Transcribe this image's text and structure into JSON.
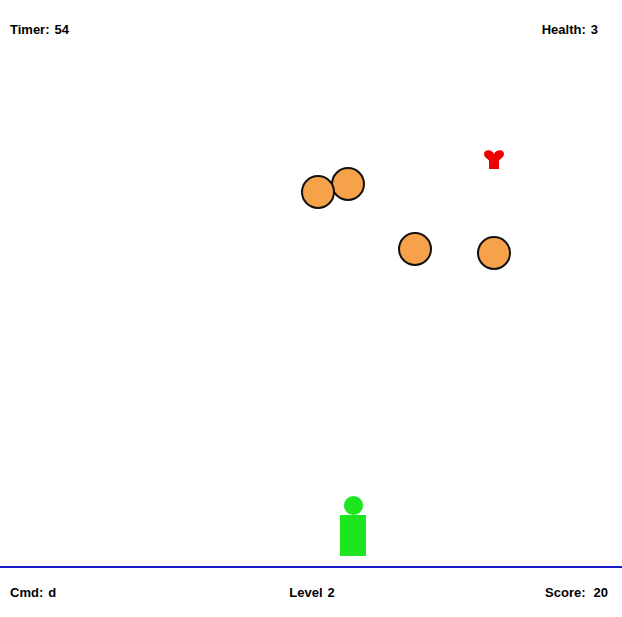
{
  "hud": {
    "timer": {
      "label": "Timer:",
      "value": "54"
    },
    "health": {
      "label": "Health:",
      "value": "3"
    }
  },
  "sprites": [
    {
      "kind": "ball"
    },
    {
      "kind": "ball"
    },
    {
      "kind": "ball"
    },
    {
      "kind": "ball"
    },
    {
      "kind": "heart"
    },
    {
      "kind": "player"
    }
  ],
  "status_bar": {
    "command": {
      "label": "Cmd:",
      "value": "d"
    },
    "level": {
      "label": "Level",
      "value": "2"
    },
    "score": {
      "label": "Score:",
      "value": "20"
    }
  }
}
